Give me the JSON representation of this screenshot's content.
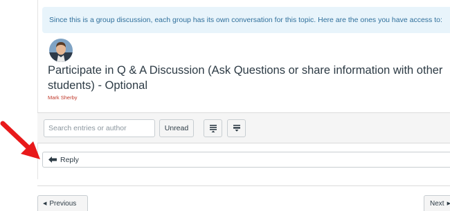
{
  "banner": {
    "text": "Since this is a group discussion, each group has its own conversation for this topic. Here are the ones you have access to:"
  },
  "topic": {
    "title": "Participate in Q & A Discussion (Ask Questions or share information with other students) - Optional",
    "author": "Mark Sherby"
  },
  "toolbar": {
    "search_placeholder": "Search entries or author",
    "unread_label": "Unread",
    "collapse_icon": "collapse-threads-icon",
    "expand_icon": "expand-threads-icon"
  },
  "reply": {
    "label": "Reply",
    "icon": "reply-arrow-icon"
  },
  "annotation": {
    "arrow_icon": "red-pointer-arrow-icon",
    "arrow_color": "#e8191a"
  },
  "pagination": {
    "previous_label": "Previous",
    "next_label": "Next"
  },
  "colors": {
    "banner_bg": "#e8f4fb",
    "banner_text": "#2f6f9b",
    "author_text": "#c0392b"
  }
}
